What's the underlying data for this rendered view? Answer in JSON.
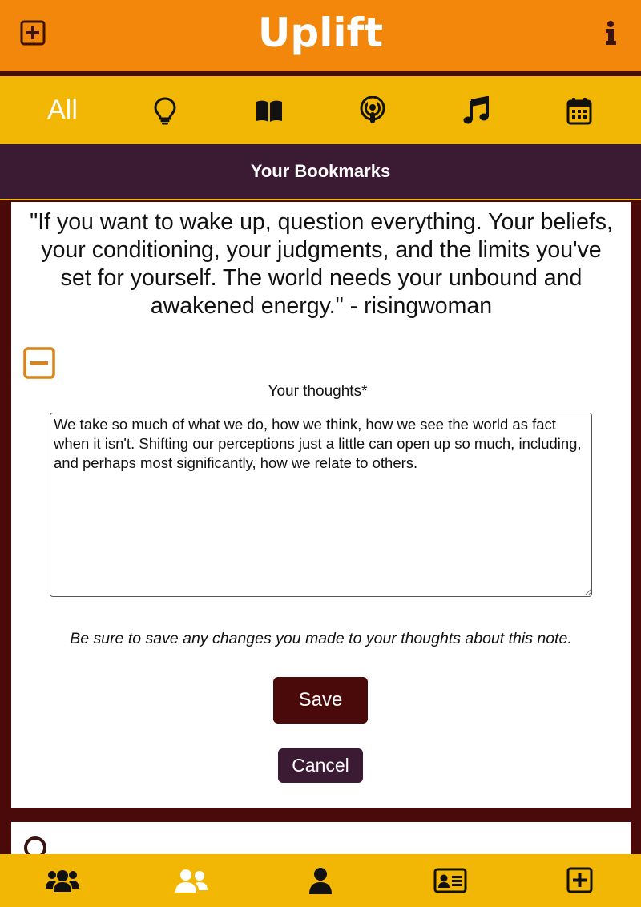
{
  "header": {
    "app_title": "Uplift",
    "add_icon": "plus-square-icon",
    "info_icon": "info-icon"
  },
  "categories": {
    "all_label": "All",
    "items": [
      {
        "icon": "lightbulb-icon"
      },
      {
        "icon": "book-icon"
      },
      {
        "icon": "podcast-icon"
      },
      {
        "icon": "music-icon"
      },
      {
        "icon": "calendar-icon"
      }
    ]
  },
  "page": {
    "title": "Your Bookmarks"
  },
  "bookmark": {
    "quote": "\"If you want to wake up, question everything. Your beliefs, your conditioning, your judgments, and the limits you've set for yourself. The world needs your unbound and awakened energy.\" - risingwoman",
    "collapse_icon": "minus-square-icon",
    "thoughts_label": "Your thoughts*",
    "thoughts_value": "We take so much of what we do, how we think, how we see the world as fact when it isn't. Shifting our perceptions just a little can open up so much, including, and perhaps most significantly, how we relate to others.",
    "save_note": "Be sure to save any changes you made to your thoughts about this note.",
    "save_label": "Save",
    "cancel_label": "Cancel"
  },
  "next_card": {
    "icon": "circle-icon"
  },
  "bottom_nav": {
    "items": [
      {
        "icon": "users-icon"
      },
      {
        "icon": "user-friends-icon"
      },
      {
        "icon": "user-icon"
      },
      {
        "icon": "id-card-icon"
      },
      {
        "icon": "plus-square-icon"
      }
    ]
  },
  "colors": {
    "header_orange": "#f2870b",
    "bar_yellow": "#f2b705",
    "title_purple": "#3b1a33",
    "maroon": "#4b0a0a",
    "accent_orange": "#d9831a"
  }
}
